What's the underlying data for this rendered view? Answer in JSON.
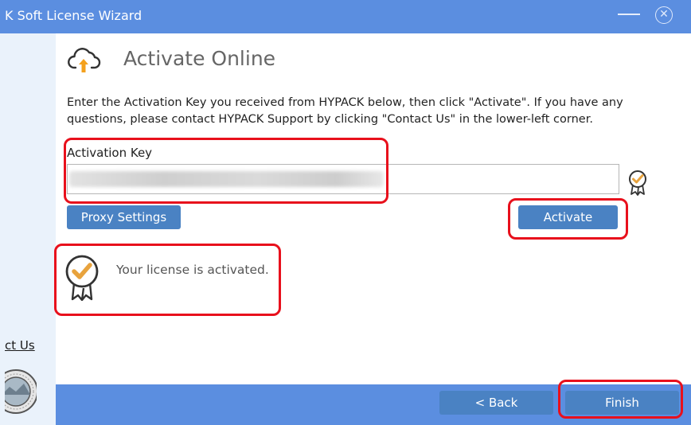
{
  "window": {
    "title": "K Soft License Wizard"
  },
  "page": {
    "heading": "Activate Online",
    "description": "Enter the Activation Key you received from HYPACK below, then click \"Activate\". If you have any questions, please contact HYPACK Support by clicking \"Contact Us\" in the lower-left corner."
  },
  "activation": {
    "label": "Activation Key"
  },
  "buttons": {
    "proxy": "Proxy Settings",
    "activate": "Activate",
    "back": "< Back",
    "finish": "Finish"
  },
  "status": {
    "message": "Your license is activated."
  },
  "sidebar": {
    "contact": "ct Us"
  },
  "colors": {
    "accent": "#5b8ee0",
    "button": "#4a82c3",
    "highlight": "#e8101c",
    "badge": "#e8a33d"
  }
}
